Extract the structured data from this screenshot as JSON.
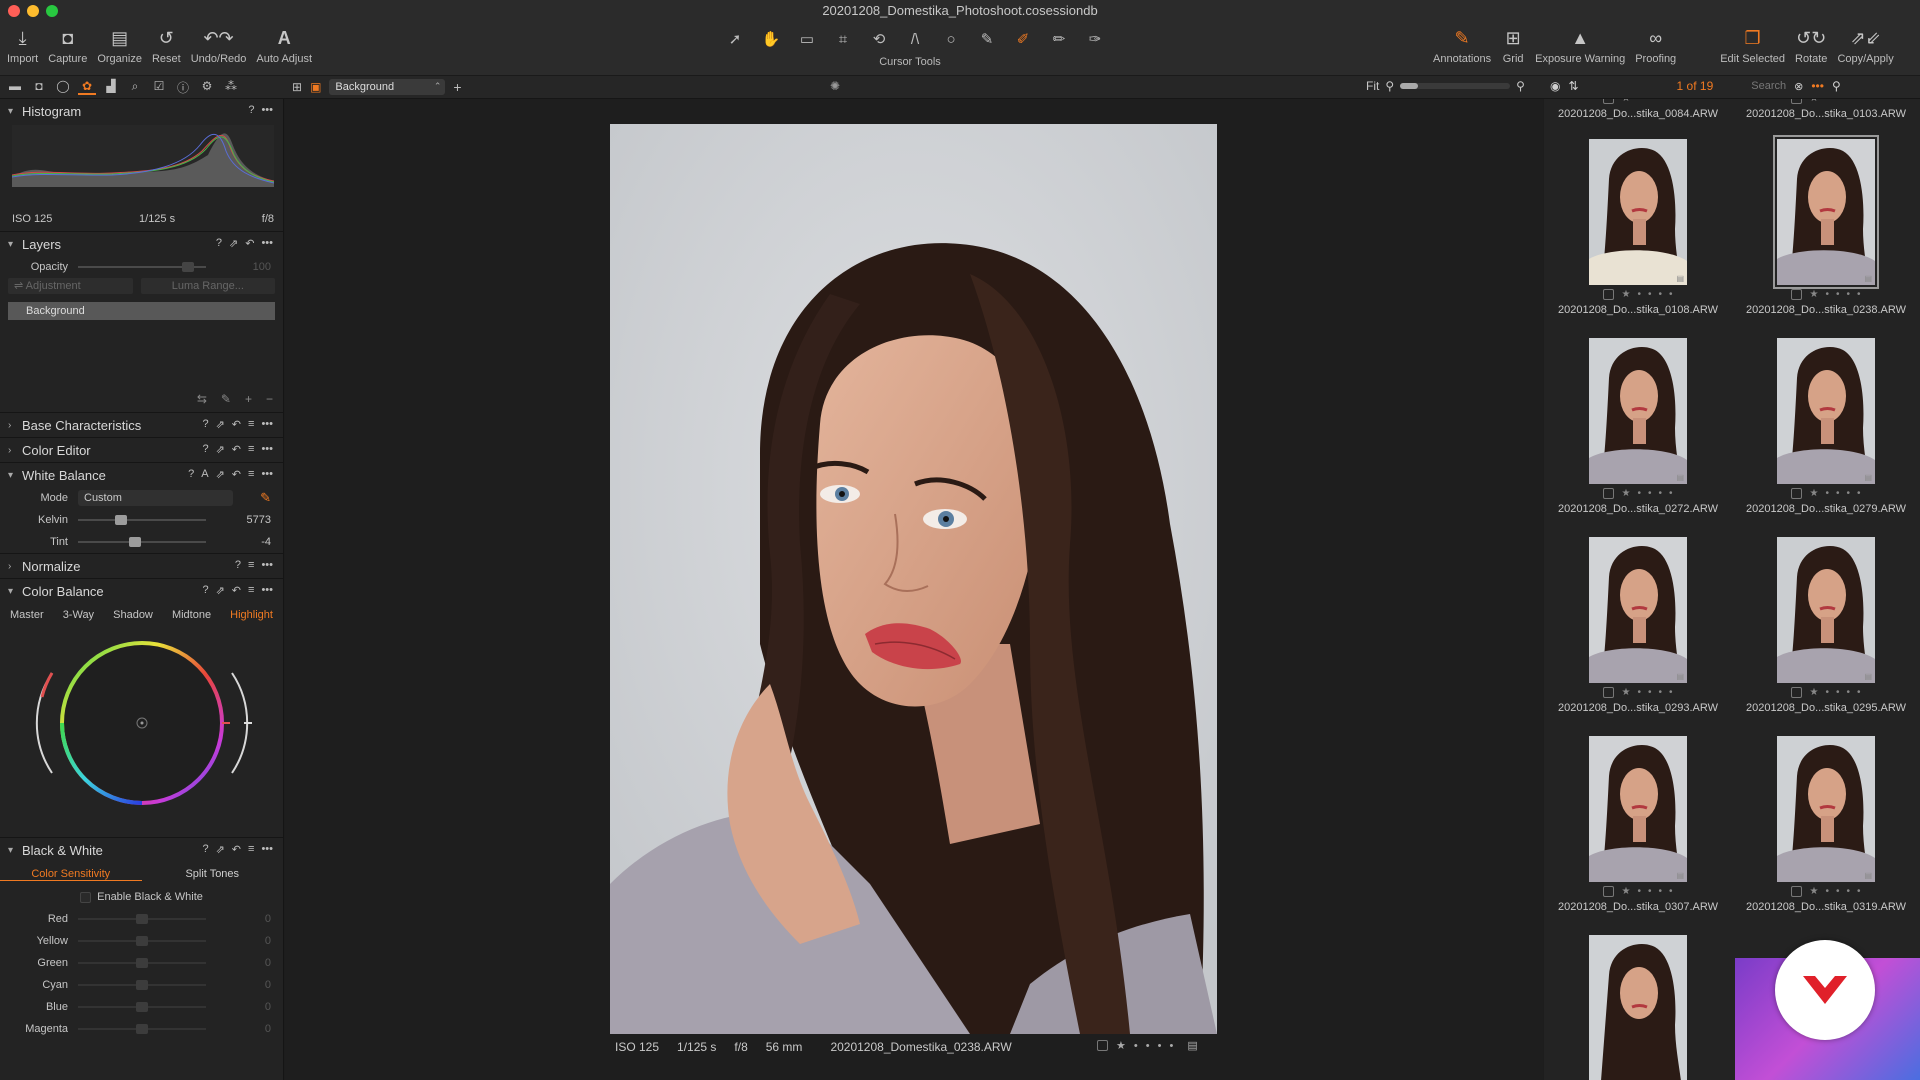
{
  "window": {
    "title": "20201208_Domestika_Photoshoot.cosessiondb"
  },
  "toolbar": {
    "left": [
      {
        "label": "Import",
        "icon": "import-icon"
      },
      {
        "label": "Capture",
        "icon": "camera-icon"
      },
      {
        "label": "Organize",
        "icon": "organize-icon"
      },
      {
        "label": "Reset",
        "icon": "reset-icon"
      },
      {
        "label": "Undo/Redo",
        "icon": "undo-icon"
      },
      {
        "label": "Auto Adjust",
        "icon": "auto-adjust-icon"
      }
    ],
    "cursor_tools_label": "Cursor Tools",
    "right": [
      {
        "label": "Annotations",
        "icon": "annotations-icon"
      },
      {
        "label": "Grid",
        "icon": "grid-icon"
      },
      {
        "label": "Exposure Warning",
        "icon": "warning-icon"
      },
      {
        "label": "Proofing",
        "icon": "proofing-icon"
      },
      {
        "label": "Edit Selected",
        "icon": "edit-selected-icon"
      },
      {
        "label": "Rotate",
        "icon": "rotate-icon"
      },
      {
        "label": "Copy/Apply",
        "icon": "copy-apply-icon"
      }
    ]
  },
  "viewer_bar": {
    "layer": "Background",
    "fit": "Fit"
  },
  "browser_bar": {
    "counter": "1 of 19",
    "search_placeholder": "Search"
  },
  "tools": {
    "histogram": {
      "title": "Histogram",
      "iso": "ISO 125",
      "shutter": "1/125 s",
      "aperture": "f/8"
    },
    "layers": {
      "title": "Layers",
      "opacity_label": "Opacity",
      "opacity_value": "100",
      "adjustment": "Adjustment",
      "luma": "Luma Range...",
      "background_layer": "Background"
    },
    "base_characteristics": "Base Characteristics",
    "color_editor": "Color Editor",
    "white_balance": {
      "title": "White Balance",
      "mode_label": "Mode",
      "mode_value": "Custom",
      "kelvin_label": "Kelvin",
      "kelvin_value": "5773",
      "kelvin_level": 0.32,
      "tint_label": "Tint",
      "tint_value": "-4",
      "tint_level": 0.44
    },
    "normalize": "Normalize",
    "color_balance": {
      "title": "Color Balance",
      "tabs": [
        "Master",
        "3-Way",
        "Shadow",
        "Midtone",
        "Highlight"
      ],
      "active_tab": "Highlight"
    },
    "black_white": {
      "title": "Black & White",
      "tabs": [
        "Color Sensitivity",
        "Split Tones"
      ],
      "active_tab": "Color Sensitivity",
      "enable_label": "Enable Black & White",
      "sliders": [
        {
          "label": "Red",
          "value": "0"
        },
        {
          "label": "Yellow",
          "value": "0"
        },
        {
          "label": "Green",
          "value": "0"
        },
        {
          "label": "Cyan",
          "value": "0"
        },
        {
          "label": "Blue",
          "value": "0"
        },
        {
          "label": "Magenta",
          "value": "0"
        }
      ]
    }
  },
  "photo_meta": {
    "iso": "ISO 125",
    "shutter": "1/125 s",
    "aperture": "f/8",
    "focal": "56 mm",
    "filename": "20201208_Domestika_0238.ARW"
  },
  "thumbnails": [
    {
      "name": "20201208_Do...stika_0084.ARW"
    },
    {
      "name": "20201208_Do...stika_0103.ARW"
    },
    {
      "name": "20201208_Do...stika_0108.ARW"
    },
    {
      "name": "20201208_Do...stika_0238.ARW",
      "selected": true
    },
    {
      "name": "20201208_Do...stika_0272.ARW"
    },
    {
      "name": "20201208_Do...stika_0279.ARW"
    },
    {
      "name": "20201208_Do...stika_0293.ARW"
    },
    {
      "name": "20201208_Do...stika_0295.ARW"
    },
    {
      "name": "20201208_Do...stika_0307.ARW"
    },
    {
      "name": "20201208_Do...stika_0319.ARW"
    }
  ],
  "colors": {
    "accent": "#f07a22",
    "bg": "#1d1d1d",
    "panel": "#232323"
  }
}
